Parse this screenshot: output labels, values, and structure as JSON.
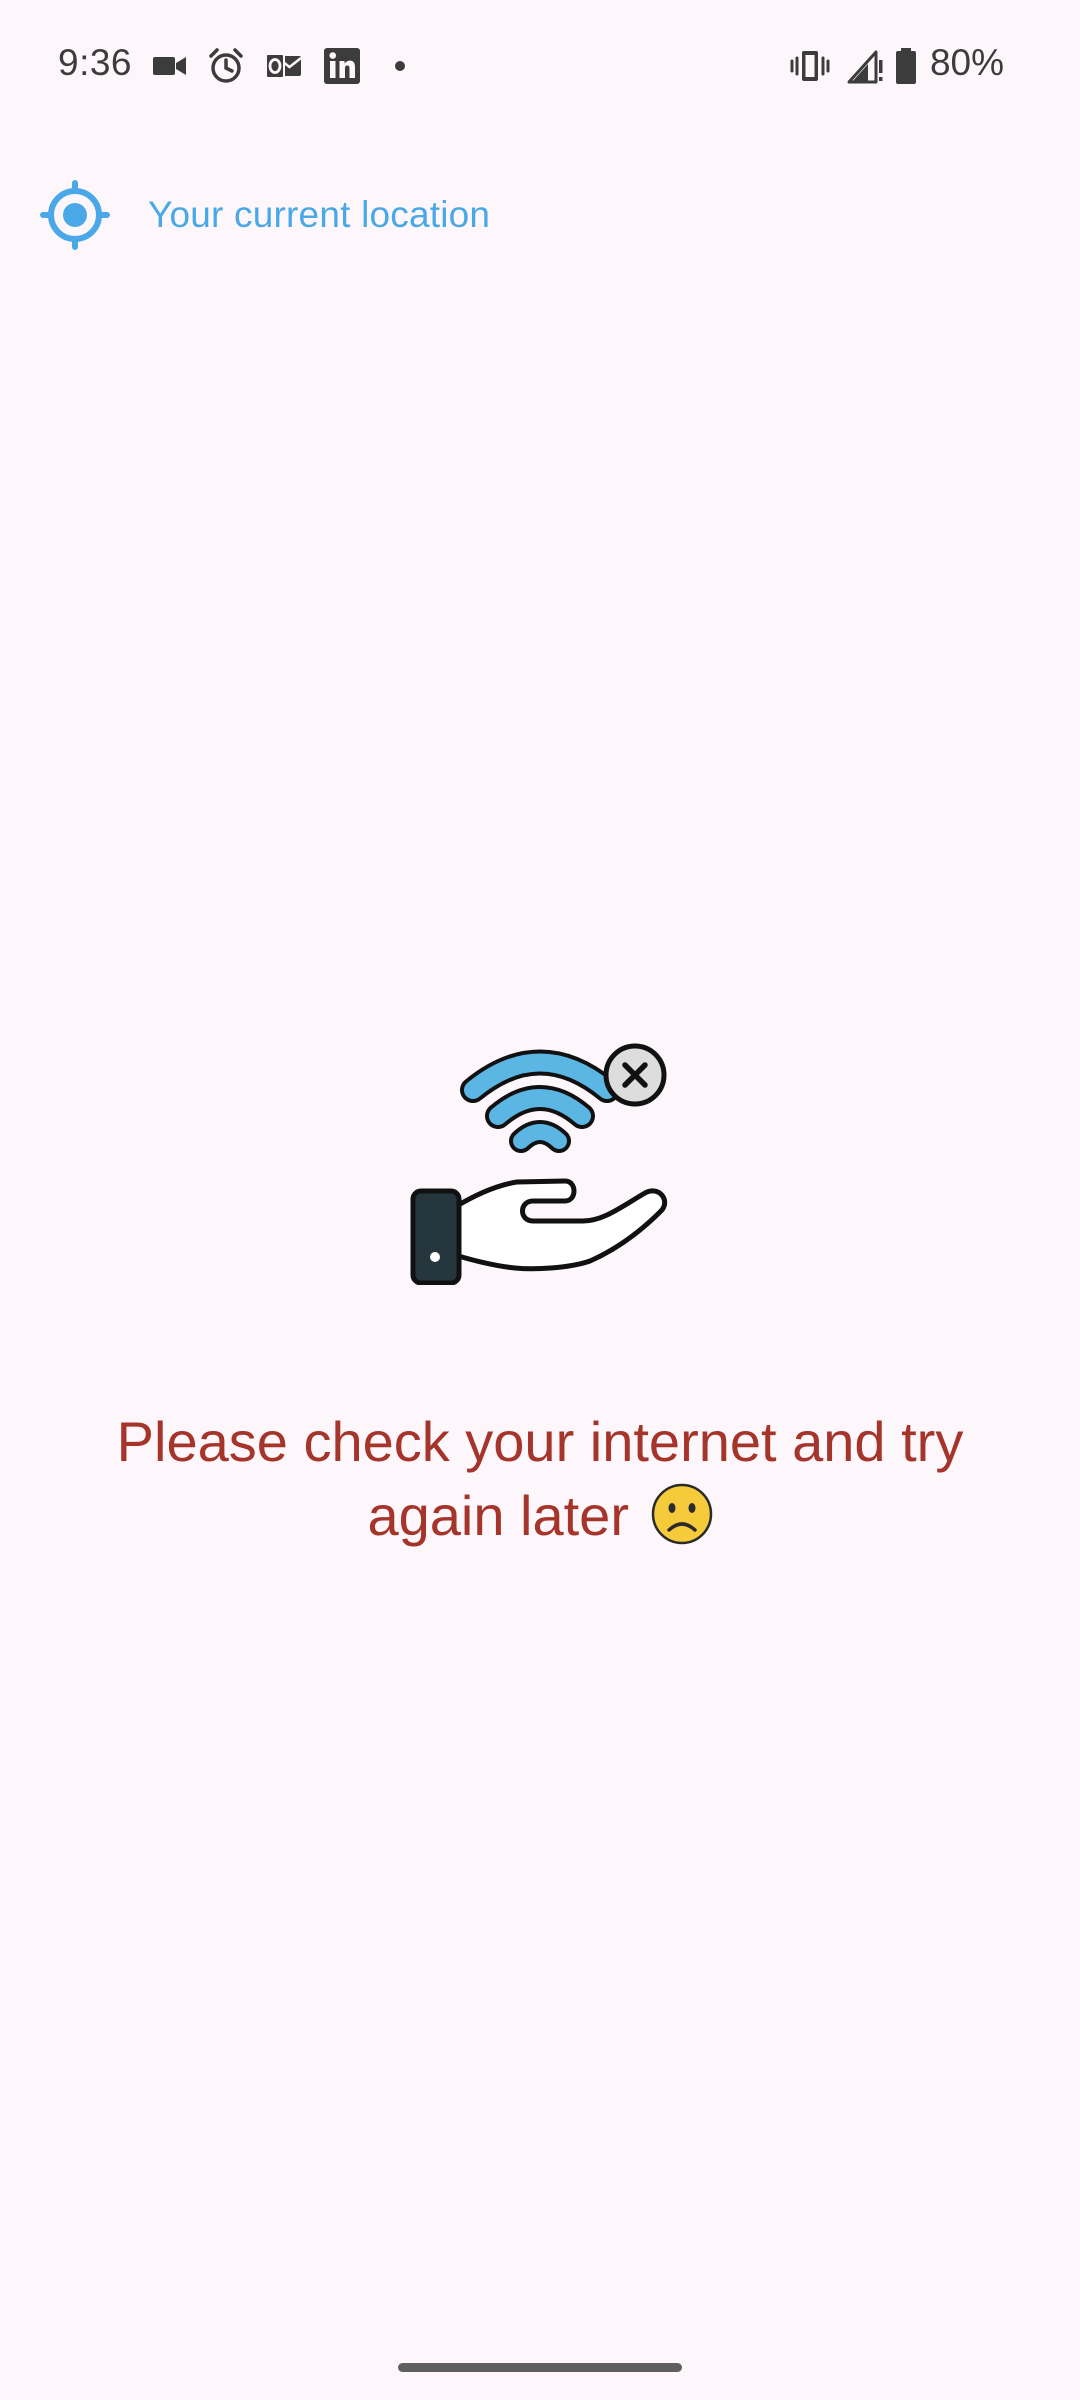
{
  "status_bar": {
    "time": "9:36",
    "battery_percent": "80%",
    "left_icons": [
      "video-camera-icon",
      "alarm-icon",
      "outlook-icon",
      "linkedin-icon",
      "notification-dot-icon"
    ],
    "right_icons": [
      "vibrate-icon",
      "signal-icon",
      "battery-icon"
    ]
  },
  "location": {
    "icon": "crosshair-location-icon",
    "label": "Your current location",
    "color": "#4AA8E8"
  },
  "error": {
    "illustration": "no-wifi-hand-illustration",
    "message": "Please check your internet and try again later",
    "emoji": "☹️",
    "color": "#A5342B"
  },
  "colors": {
    "background": "#FDF7FB",
    "accent": "#4AA8E8",
    "error_text": "#A5342B",
    "wifi_blue": "#5BB6E4"
  }
}
